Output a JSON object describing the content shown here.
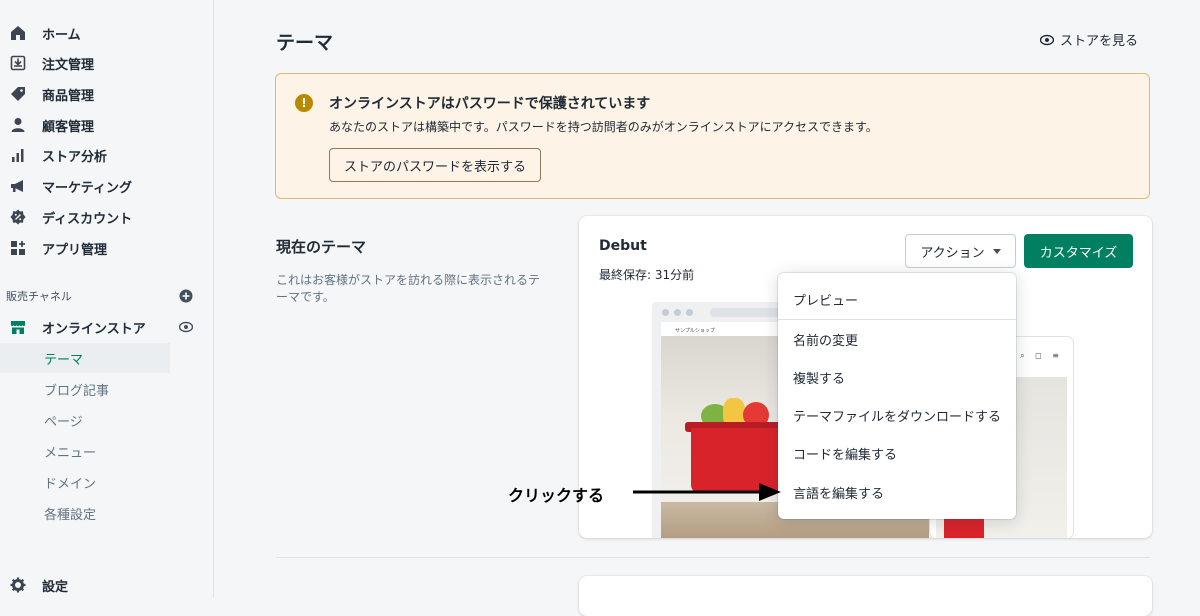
{
  "sidebar": {
    "items": [
      {
        "label": "ホーム",
        "icon": "home-icon"
      },
      {
        "label": "注文管理",
        "icon": "orders-icon"
      },
      {
        "label": "商品管理",
        "icon": "tag-icon"
      },
      {
        "label": "顧客管理",
        "icon": "person-icon"
      },
      {
        "label": "ストア分析",
        "icon": "bar-chart-icon"
      },
      {
        "label": "マーケティング",
        "icon": "megaphone-icon"
      },
      {
        "label": "ディスカウント",
        "icon": "discount-icon"
      },
      {
        "label": "アプリ管理",
        "icon": "apps-icon"
      }
    ],
    "channels_label": "販売チャネル",
    "online_store": "オンラインストア",
    "sub_items": [
      "テーマ",
      "ブログ記事",
      "ページ",
      "メニュー",
      "ドメイン",
      "各種設定"
    ],
    "settings": "設定"
  },
  "header": {
    "title": "テーマ",
    "view_store": "ストアを見る"
  },
  "banner": {
    "title": "オンラインストアはパスワードで保護されています",
    "text": "あなたのストアは構築中です。パスワードを持つ訪問者のみがオンラインストアにアクセスできます。",
    "button": "ストアのパスワードを表示する",
    "icon_glyph": "!"
  },
  "current_theme": {
    "title": "現在のテーマ",
    "description": "これはお客様がストアを訪れる際に表示されるテーマです。",
    "theme_name": "Debut",
    "last_saved": "最終保存: 31分前",
    "action_button": "アクション",
    "customize_button": "カスタマイズ",
    "preview_shop_name": "サンプルショップ"
  },
  "action_menu": [
    "プレビュー",
    "名前の変更",
    "複製する",
    "テーマファイルをダウンロードする",
    "コードを編集する",
    "言語を編集する"
  ],
  "annotation": "クリックする",
  "colors": {
    "accent": "#008060",
    "banner_bg": "#fdf3e6",
    "banner_border": "#e1b878"
  }
}
